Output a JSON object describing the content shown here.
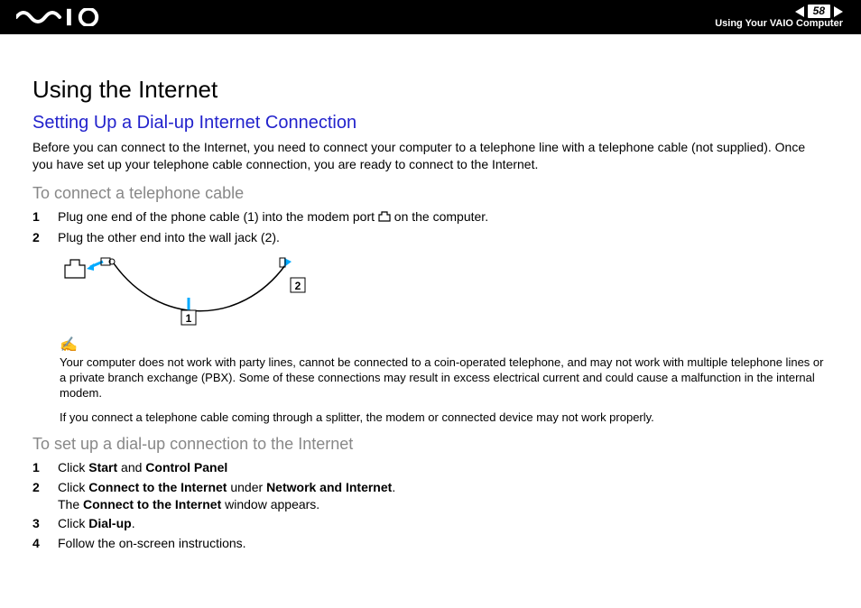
{
  "header": {
    "logo_alt": "VAIO",
    "page_number": "58",
    "subtitle": "Using Your VAIO Computer"
  },
  "h1": "Using the Internet",
  "h2": "Setting Up a Dial-up Internet Connection",
  "intro": "Before you can connect to the Internet, you need to connect your computer to a telephone line with a telephone cable (not supplied). Once you have set up your telephone cable connection, you are ready to connect to the Internet.",
  "section1": {
    "heading": "To connect a telephone cable",
    "steps": [
      {
        "n": "1",
        "pre": "Plug one end of the phone cable (1) into the modem port ",
        "post": " on the computer."
      },
      {
        "n": "2",
        "pre": "Plug the other end into the wall jack (2).",
        "post": ""
      }
    ]
  },
  "diagram": {
    "label1": "1",
    "label2": "2"
  },
  "note_icon": "✍",
  "note_text": "Your computer does not work with party lines, cannot be connected to a coin-operated telephone, and may not work with multiple telephone lines or a private branch exchange (PBX). Some of these connections may result in excess electrical current and could cause a malfunction in the internal modem.",
  "note_extra": "If you connect a telephone cable coming through a splitter, the modem or connected device may not work properly.",
  "section2": {
    "heading": "To set up a dial-up connection to the Internet",
    "steps": {
      "s1": {
        "n": "1",
        "a": "Click ",
        "b1": "Start",
        "mid": " and ",
        "b2": "Control Panel"
      },
      "s2": {
        "n": "2",
        "a": "Click ",
        "b1": "Connect to the Internet",
        "mid": " under ",
        "b2": "Network and Internet",
        "end": ".",
        "line2a": "The ",
        "line2b": "Connect to the Internet",
        "line2c": " window appears."
      },
      "s3": {
        "n": "3",
        "a": "Click ",
        "b1": "Dial-up",
        "end": "."
      },
      "s4": {
        "n": "4",
        "a": "Follow the on-screen instructions."
      }
    }
  }
}
